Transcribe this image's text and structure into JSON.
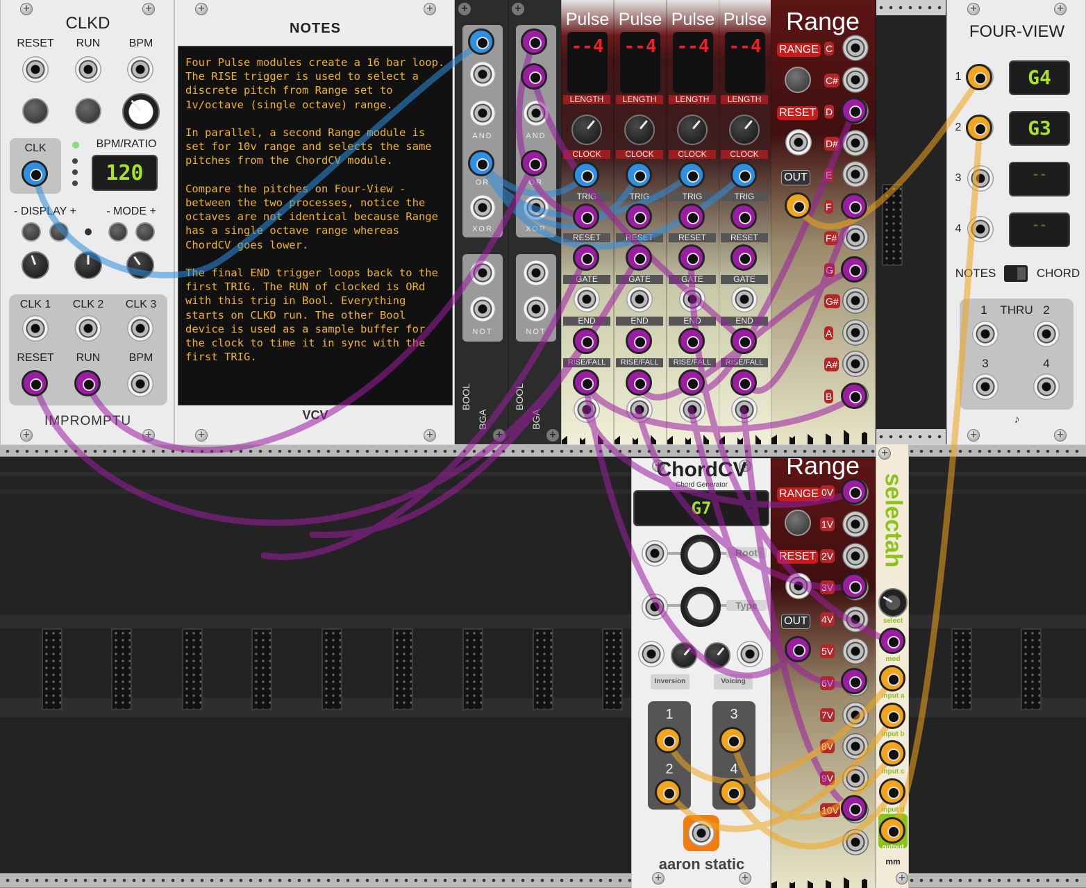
{
  "clkd": {
    "title": "CLKD",
    "reset": "RESET",
    "run": "RUN",
    "bpm": "BPM",
    "clk": "CLK",
    "bpm_ratio": "BPM/RATIO",
    "display_value": "120",
    "display_btn": "- DISPLAY +",
    "mode_btn": "- MODE +",
    "clk1": "CLK 1",
    "clk2": "CLK 2",
    "clk3": "CLK 3",
    "out_reset": "RESET",
    "out_run": "RUN",
    "out_bpm": "BPM",
    "brand": "IMPROMPTU"
  },
  "notes": {
    "title": "NOTES",
    "text": "Four Pulse modules create a 16 bar loop. The RISE trigger is used to select a discrete pitch from Range set to 1v/octave (single octave) range.\n\nIn parallel, a second Range module is set for 10v range and selects the same pitches from the ChordCV module.\n\nCompare the pitches on Four-View - between the two processes, notice the octaves are not identical because Range has a single octave range whereas ChordCV goes lower.\n\nThe final END trigger loops back to the first TRIG. The RUN of clocked is ORd with this trig in Bool. Everything starts on CLKD run. The other Bool device is used as a sample buffer for the clock to time it in sync with the first TRIG.",
    "brand": "VCV"
  },
  "bool": {
    "and": "AND",
    "or": "OR",
    "xor": "XOR",
    "not": "NOT",
    "brand": "BOOL",
    "maker": "BGA"
  },
  "pulse": {
    "title": "Pulse",
    "display": "--4",
    "length": "LENGTH",
    "clock": "CLOCK",
    "trig": "TRIG",
    "reset": "RESET",
    "gate": "GATE",
    "end": "END",
    "risefall": "RISE/FALL"
  },
  "range1": {
    "title": "Range",
    "range_btn": "RANGE",
    "reset": "RESET",
    "out": "OUT",
    "notes": [
      "C",
      "C#",
      "D",
      "D#",
      "E",
      "F",
      "F#",
      "G",
      "G#",
      "A",
      "A#",
      "B"
    ]
  },
  "range2": {
    "title": "Range",
    "range_btn": "RANGE",
    "reset": "RESET",
    "out": "OUT",
    "volts": [
      "0V",
      "1V",
      "2V",
      "3V",
      "4V",
      "5V",
      "6V",
      "7V",
      "8V",
      "9V",
      "10V"
    ]
  },
  "fourview": {
    "title": "FOUR-VIEW",
    "ch": [
      "1",
      "2",
      "3",
      "4"
    ],
    "displays": [
      "G4",
      "G3",
      "--",
      "--"
    ],
    "notes": "NOTES",
    "chord": "CHORD",
    "thru": "THRU",
    "thru_nums": [
      "1",
      "2",
      "3",
      "4"
    ]
  },
  "chordcv": {
    "title": "ChordCV",
    "subtitle": "Chord Generator",
    "display": "G7",
    "root": "Root",
    "type": "Type",
    "inversion": "Inversion",
    "voicing": "Voicing",
    "outs": [
      "1",
      "2",
      "3",
      "4"
    ],
    "brand": "aaron static"
  },
  "selectah": {
    "title": "selectah",
    "select": "select",
    "mod": "mod",
    "input_a": "input a",
    "input_b": "input b",
    "input_c": "input c",
    "input_d": "input d",
    "output": "output",
    "brand": "mm"
  },
  "colors": {
    "blue": "#2f8fe0",
    "purple": "#9b1ea2",
    "orange": "#f0a51c",
    "pulse_red": "#9c1d1d",
    "lcd_green": "#a8e32a"
  }
}
